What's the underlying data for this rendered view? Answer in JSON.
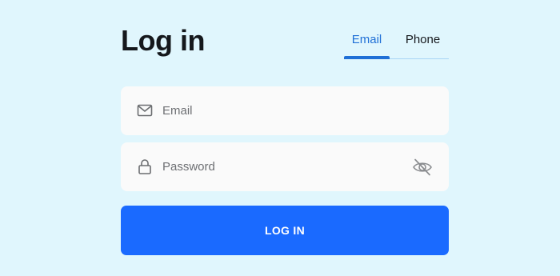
{
  "form": {
    "title": "Log in",
    "tabs": [
      {
        "label": "Email",
        "active": true
      },
      {
        "label": "Phone",
        "active": false
      }
    ],
    "email_field": {
      "placeholder": "Email",
      "value": "",
      "icon": "mail-icon"
    },
    "password_field": {
      "placeholder": "Password",
      "value": "",
      "icon": "lock-icon",
      "toggle_icon": "eye-off-icon"
    },
    "submit_label": "LOG IN"
  },
  "colors": {
    "background": "#e0f6fd",
    "accent": "#1a6aff",
    "active_tab": "#1f6fd6",
    "field_bg": "#fafafa",
    "title": "#15181c"
  }
}
